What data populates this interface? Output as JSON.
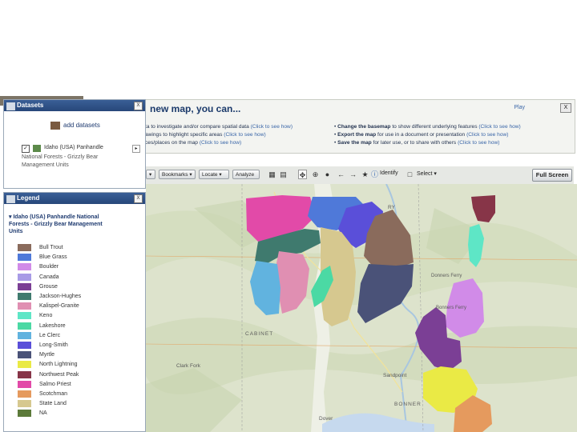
{
  "datasets_panel": {
    "title": "Datasets",
    "add_label": "add datasets",
    "layer_name_lines": [
      "Idaho (USA) Panhandle",
      "National Forests - Grizzly Bear",
      "Management Units"
    ],
    "layer_checked": true,
    "close_label": "X"
  },
  "banner": {
    "title": "new map, you can...",
    "play_label": "Play",
    "close_label": "X",
    "left_lines": [
      {
        "text": "ta to investigate and/or compare spatial data",
        "link": "(Click to see how)"
      },
      {
        "text": "awings to highlight specific areas",
        "link": "(Click to see how)"
      },
      {
        "text": "ces/places on the map",
        "link": "(Click to see how)"
      }
    ],
    "right_lines": [
      {
        "bold": "Change the basemap",
        "text": "to show different underlying features",
        "link": "(Click to see how)"
      },
      {
        "bold": "Export the map",
        "text": "for use in a document or presentation",
        "link": "(Click to see how)"
      },
      {
        "bold": "Save the map",
        "text": "for later use, or to share with others",
        "link": "(Click to see how)"
      }
    ]
  },
  "toolbar": {
    "buttons": [
      "Bookmarks",
      "Locate",
      "Analyze"
    ],
    "first_label": "▾",
    "identify_label": "Identify",
    "select_label": "Select",
    "fullscreen_label": "Full Screen"
  },
  "legend": {
    "title": "Legend",
    "close_label": "X",
    "layer_title_lines": [
      "Idaho (USA) Panhandle National",
      "Forests - Grizzly Bear Management",
      "Units"
    ],
    "items": [
      {
        "label": "Bull Trout",
        "color": "#8a6b5c"
      },
      {
        "label": "Blue Grass",
        "color": "#4f79d9"
      },
      {
        "label": "Boulder",
        "color": "#d18be8"
      },
      {
        "label": "Canada",
        "color": "#a89be6"
      },
      {
        "label": "Grouse",
        "color": "#7b3f95"
      },
      {
        "label": "Jackson-Hughes",
        "color": "#3f7a6e"
      },
      {
        "label": "Kalispel-Granite",
        "color": "#e08fb2"
      },
      {
        "label": "Keno",
        "color": "#5ee6c6"
      },
      {
        "label": "Lakeshore",
        "color": "#4bd9a4"
      },
      {
        "label": "Le Clerc",
        "color": "#61b3df"
      },
      {
        "label": "Long-Smith",
        "color": "#5a4fd9"
      },
      {
        "label": "Myrtle",
        "color": "#4a5278"
      },
      {
        "label": "North Lightning",
        "color": "#eaea45"
      },
      {
        "label": "Northwest Peak",
        "color": "#873548"
      },
      {
        "label": "Salmo Priest",
        "color": "#e24aa8"
      },
      {
        "label": "Scotchman",
        "color": "#e59a5e"
      },
      {
        "label": "State Land",
        "color": "#d6c88f"
      },
      {
        "label": "NA",
        "color": "#5c7a3a"
      }
    ]
  },
  "map": {
    "labels": [
      "RY",
      "Donners Ferry",
      "Bonners Ferry",
      "Sandpoint",
      "BONNER",
      "CABINET",
      "Clark Fork",
      "Dover"
    ]
  },
  "colors": {
    "panel_header": "#2f5185",
    "banner_bg": "#f3f4f1"
  }
}
